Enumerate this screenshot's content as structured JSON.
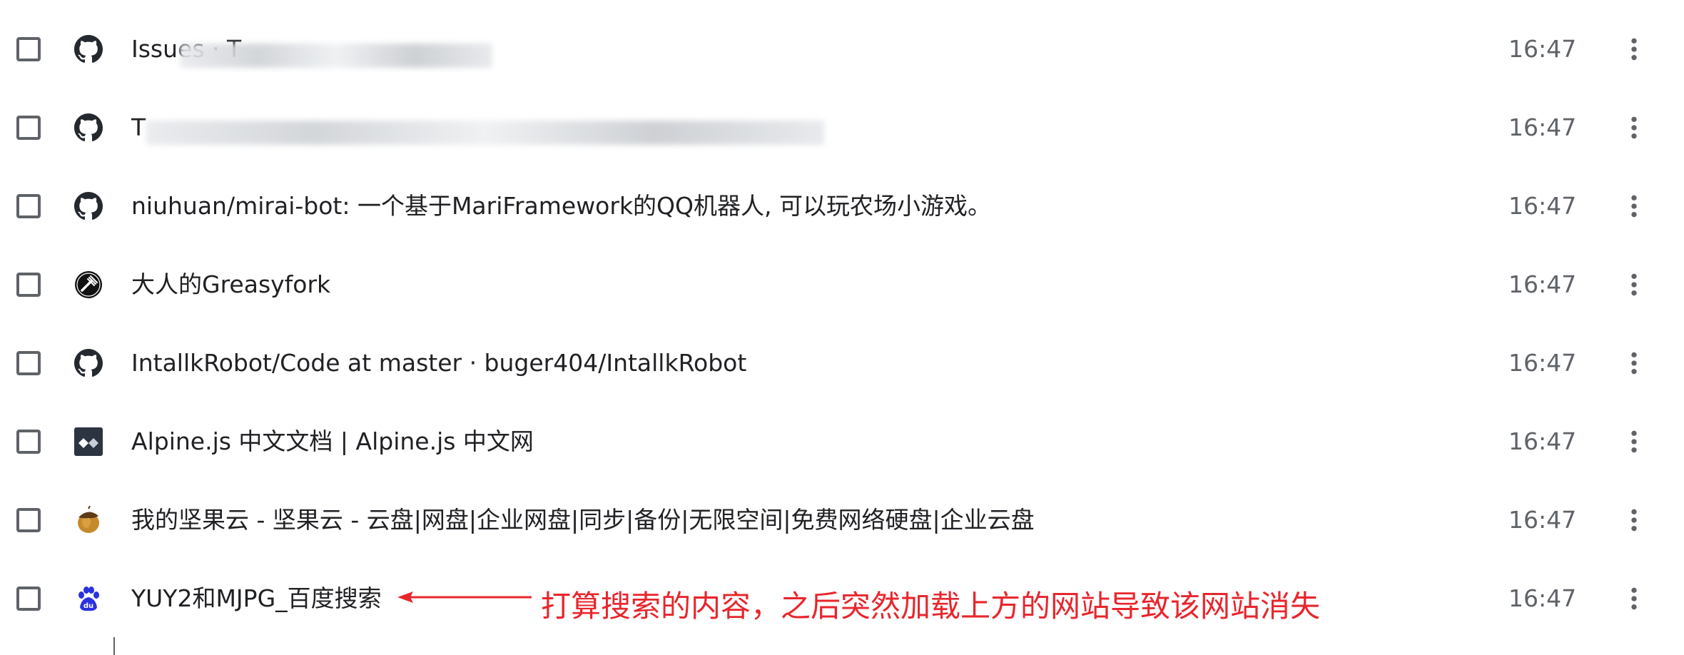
{
  "history": {
    "items": [
      {
        "icon": "github-icon",
        "title": "Issues · T",
        "time": "16:47"
      },
      {
        "icon": "github-icon",
        "title": "T",
        "time": "16:47"
      },
      {
        "icon": "github-icon",
        "title": "niuhuan/mirai-bot: 一个基于MariFramework的QQ机器人, 可以玩农场小游戏。",
        "time": "16:47"
      },
      {
        "icon": "greasyfork-icon",
        "title": "大人的Greasyfork",
        "time": "16:47"
      },
      {
        "icon": "github-icon",
        "title": "IntallkRobot/Code at master · buger404/IntallkRobot",
        "time": "16:47"
      },
      {
        "icon": "alpinejs-icon",
        "title": "Alpine.js 中文文档 | Alpine.js 中文网",
        "time": "16:47"
      },
      {
        "icon": "jianguoyun-icon",
        "title": "我的坚果云 - 坚果云 - 云盘|网盘|企业网盘|同步|备份|无限空间|免费网络硬盘|企业云盘",
        "time": "16:47"
      },
      {
        "icon": "baidu-icon",
        "title": "YUY2和MJPG_百度搜索",
        "time": "16:47"
      }
    ]
  },
  "annotation": {
    "text": "打算搜索的内容，之后突然加载上方的网站导致该网站消失",
    "color": "#e8262d"
  }
}
